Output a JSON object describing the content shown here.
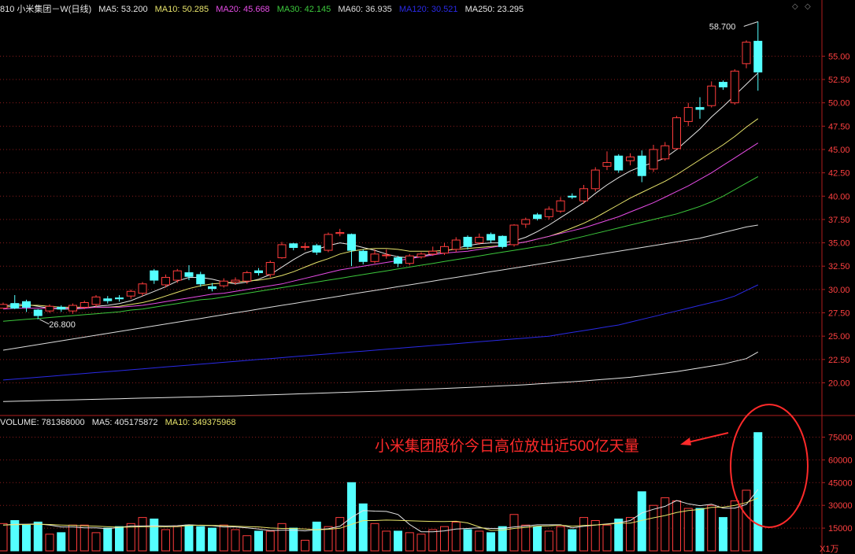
{
  "header": {
    "title": "810 小米集团－W(日线)",
    "ma5": "MA5: 53.200",
    "ma10": "MA10: 50.285",
    "ma20": "MA20: 45.668",
    "ma30": "MA30: 42.145",
    "ma60": "MA60: 36.935",
    "ma120": "MA120: 30.521",
    "ma250": "MA250: 23.295"
  },
  "volume_header": {
    "volume": "VOLUME: 781368000",
    "ma5": "MA5: 405175872",
    "ma10": "MA10: 349375968"
  },
  "annotation": "小米集团股价今日高位放出近500亿天量",
  "colors": {
    "up": "#ff3c3c",
    "down": "#54ffff",
    "ma5": "#e6e6e6",
    "ma10": "#e8e46b",
    "ma20": "#e64ce6",
    "ma30": "#3cc83c",
    "ma60": "#dcdcdc",
    "ma120": "#2a2ae6",
    "ma250": "#e6e6e6",
    "grid": "#8a1c1c",
    "annotation": "#ff2a2a"
  },
  "chart_data": [
    {
      "type": "candlestick",
      "title": "810 小米集团－W(日线)",
      "y_ticks": [
        "55.00",
        "52.50",
        "50.00",
        "47.50",
        "45.00",
        "42.50",
        "40.00",
        "37.50",
        "35.00",
        "32.50",
        "30.00",
        "27.50",
        "25.00",
        "22.50",
        "20.00"
      ],
      "ylim": [
        16.5,
        59.5
      ],
      "high_marker": "58.700",
      "low_marker": "26.800",
      "candles": [
        [
          28.0,
          28.4,
          28.0,
          28.6
        ],
        [
          28.5,
          28.0,
          27.9,
          29.4
        ],
        [
          28.7,
          28.1,
          27.6,
          28.9
        ],
        [
          27.8,
          27.2,
          26.8,
          27.9
        ],
        [
          27.7,
          28.2,
          27.5,
          28.4
        ],
        [
          28.1,
          27.9,
          27.6,
          28.3
        ],
        [
          27.7,
          28.3,
          27.4,
          28.5
        ],
        [
          28.1,
          28.6,
          27.9,
          28.8
        ],
        [
          28.4,
          29.2,
          28.1,
          29.4
        ],
        [
          29.0,
          28.8,
          28.5,
          29.3
        ],
        [
          29.1,
          29.0,
          28.7,
          29.4
        ],
        [
          29.3,
          29.8,
          29.0,
          30.0
        ],
        [
          29.6,
          30.6,
          29.3,
          30.8
        ],
        [
          32.0,
          31.0,
          30.6,
          32.2
        ],
        [
          30.5,
          31.3,
          30.2,
          31.6
        ],
        [
          31.0,
          32.0,
          30.7,
          32.2
        ],
        [
          31.8,
          31.4,
          31.0,
          32.6
        ],
        [
          31.6,
          30.6,
          30.3,
          31.9
        ],
        [
          30.3,
          30.1,
          29.8,
          30.7
        ],
        [
          30.4,
          30.9,
          30.2,
          31.2
        ],
        [
          30.8,
          31.0,
          30.5,
          31.3
        ],
        [
          30.9,
          31.8,
          30.6,
          32.0
        ],
        [
          32.0,
          31.8,
          31.5,
          32.3
        ],
        [
          31.6,
          32.9,
          31.3,
          33.1
        ],
        [
          33.4,
          34.8,
          33.3,
          35.1
        ],
        [
          34.9,
          34.5,
          34.2,
          35.0
        ],
        [
          34.6,
          34.6,
          34.2,
          35.0
        ],
        [
          34.7,
          34.0,
          33.7,
          34.9
        ],
        [
          34.2,
          35.9,
          34.0,
          36.1
        ],
        [
          36.0,
          36.1,
          35.7,
          36.5
        ],
        [
          35.9,
          34.2,
          32.5,
          36.0
        ],
        [
          34.1,
          33.0,
          32.7,
          34.3
        ],
        [
          33.0,
          33.8,
          32.8,
          34.3
        ],
        [
          33.7,
          33.7,
          33.3,
          34.3
        ],
        [
          33.4,
          32.8,
          32.4,
          33.6
        ],
        [
          32.8,
          33.6,
          32.6,
          33.8
        ],
        [
          33.5,
          33.8,
          33.3,
          34.0
        ],
        [
          33.8,
          34.1,
          33.6,
          34.6
        ],
        [
          33.9,
          34.6,
          33.7,
          35.0
        ],
        [
          34.3,
          35.3,
          34.0,
          35.6
        ],
        [
          35.6,
          34.6,
          34.3,
          35.8
        ],
        [
          35.0,
          35.6,
          34.8,
          36.0
        ],
        [
          35.9,
          35.3,
          35.0,
          36.1
        ],
        [
          35.7,
          34.6,
          34.4,
          35.8
        ],
        [
          34.8,
          36.9,
          34.6,
          37.0
        ],
        [
          37.0,
          37.5,
          36.6,
          37.7
        ],
        [
          38.0,
          37.6,
          37.4,
          38.2
        ],
        [
          37.8,
          38.6,
          37.5,
          38.9
        ],
        [
          38.4,
          39.5,
          38.2,
          39.9
        ],
        [
          40.0,
          39.9,
          39.7,
          40.3
        ],
        [
          39.5,
          40.8,
          39.2,
          41.2
        ],
        [
          40.8,
          42.8,
          40.5,
          43.1
        ],
        [
          43.2,
          43.6,
          42.8,
          44.8
        ],
        [
          44.3,
          42.8,
          42.5,
          44.5
        ],
        [
          43.8,
          44.2,
          43.3,
          44.6
        ],
        [
          44.3,
          42.2,
          41.5,
          44.9
        ],
        [
          42.9,
          45.0,
          42.6,
          45.5
        ],
        [
          44.0,
          45.4,
          43.8,
          45.8
        ],
        [
          45.1,
          48.4,
          45.0,
          48.6
        ],
        [
          48.0,
          49.5,
          47.5,
          50.0
        ],
        [
          49.5,
          49.3,
          48.3,
          50.6
        ],
        [
          49.7,
          51.8,
          49.5,
          52.3
        ],
        [
          52.2,
          51.7,
          51.4,
          52.4
        ],
        [
          50.0,
          53.4,
          49.8,
          53.6
        ],
        [
          54.2,
          56.5,
          53.7,
          56.7
        ],
        [
          56.6,
          53.3,
          51.3,
          58.7
        ]
      ],
      "ma_series": [
        {
          "name": "MA5",
          "values": [
            28.2,
            28.4,
            28.4,
            28.2,
            28.0,
            27.9,
            27.9,
            28.0,
            28.2,
            28.3,
            28.5,
            28.8,
            29.3,
            29.8,
            30.3,
            30.9,
            31.3,
            31.3,
            31.1,
            30.8,
            30.6,
            30.8,
            31.1,
            31.6,
            32.4,
            33.2,
            33.9,
            34.3,
            34.7,
            35.0,
            34.8,
            34.5,
            34.2,
            33.8,
            33.5,
            33.4,
            33.6,
            33.8,
            34.1,
            34.4,
            34.7,
            34.9,
            35.0,
            35.0,
            35.2,
            35.6,
            36.2,
            36.9,
            37.7,
            38.5,
            39.3,
            40.3,
            41.2,
            42.0,
            42.7,
            43.2,
            43.6,
            44.1,
            45.0,
            46.1,
            47.2,
            48.5,
            49.6,
            50.8,
            52.0,
            53.2
          ]
        },
        {
          "name": "MA10",
          "values": [
            28.1,
            28.2,
            28.3,
            28.3,
            28.2,
            28.1,
            28.1,
            28.1,
            28.1,
            28.1,
            28.2,
            28.4,
            28.6,
            28.9,
            29.3,
            29.7,
            30.1,
            30.4,
            30.6,
            30.7,
            30.8,
            30.9,
            31.0,
            31.2,
            31.5,
            31.9,
            32.4,
            32.9,
            33.3,
            33.8,
            34.1,
            34.3,
            34.4,
            34.4,
            34.3,
            34.1,
            34.1,
            34.1,
            34.2,
            34.3,
            34.4,
            34.5,
            34.6,
            34.7,
            34.9,
            35.1,
            35.4,
            35.7,
            36.1,
            36.6,
            37.1,
            37.7,
            38.4,
            39.1,
            39.8,
            40.4,
            41.0,
            41.6,
            42.3,
            43.1,
            43.9,
            44.7,
            45.5,
            46.4,
            47.4,
            48.3
          ]
        },
        {
          "name": "MA20",
          "values": [
            27.9,
            28.0,
            28.0,
            28.0,
            28.0,
            28.0,
            28.0,
            28.0,
            28.1,
            28.1,
            28.1,
            28.2,
            28.3,
            28.5,
            28.7,
            28.9,
            29.1,
            29.3,
            29.5,
            29.6,
            29.8,
            30.0,
            30.2,
            30.4,
            30.6,
            30.9,
            31.2,
            31.5,
            31.8,
            32.1,
            32.3,
            32.5,
            32.7,
            32.9,
            33.1,
            33.3,
            33.5,
            33.7,
            33.9,
            34.0,
            34.1,
            34.3,
            34.5,
            34.7,
            34.9,
            35.1,
            35.4,
            35.7,
            36.0,
            36.3,
            36.6,
            37.0,
            37.4,
            37.8,
            38.3,
            38.8,
            39.3,
            39.9,
            40.5,
            41.1,
            41.8,
            42.5,
            43.3,
            44.1,
            44.9,
            45.7
          ]
        },
        {
          "name": "MA30",
          "values": [
            26.6,
            26.7,
            26.8,
            26.9,
            27.0,
            27.1,
            27.2,
            27.3,
            27.4,
            27.5,
            27.6,
            27.8,
            27.9,
            28.1,
            28.3,
            28.5,
            28.7,
            28.9,
            29.0,
            29.2,
            29.4,
            29.6,
            29.8,
            30.0,
            30.2,
            30.4,
            30.6,
            30.8,
            31.0,
            31.2,
            31.4,
            31.6,
            31.8,
            32.0,
            32.2,
            32.4,
            32.6,
            32.8,
            33.0,
            33.2,
            33.4,
            33.6,
            33.8,
            34.0,
            34.2,
            34.4,
            34.6,
            34.8,
            35.1,
            35.4,
            35.7,
            36.0,
            36.3,
            36.6,
            36.9,
            37.2,
            37.5,
            37.8,
            38.1,
            38.5,
            38.9,
            39.4,
            40.0,
            40.7,
            41.4,
            42.1
          ]
        },
        {
          "name": "MA60",
          "values": [
            23.5,
            23.7,
            23.9,
            24.1,
            24.3,
            24.5,
            24.7,
            24.9,
            25.1,
            25.3,
            25.5,
            25.7,
            25.9,
            26.1,
            26.3,
            26.5,
            26.7,
            26.9,
            27.1,
            27.3,
            27.5,
            27.7,
            27.9,
            28.1,
            28.3,
            28.5,
            28.7,
            28.9,
            29.1,
            29.3,
            29.5,
            29.7,
            29.9,
            30.1,
            30.3,
            30.5,
            30.7,
            30.9,
            31.1,
            31.3,
            31.5,
            31.7,
            31.9,
            32.1,
            32.3,
            32.5,
            32.7,
            32.9,
            33.1,
            33.3,
            33.5,
            33.7,
            33.9,
            34.1,
            34.3,
            34.5,
            34.7,
            34.9,
            35.1,
            35.3,
            35.5,
            35.8,
            36.1,
            36.4,
            36.7,
            36.9
          ]
        },
        {
          "name": "MA120",
          "values": [
            20.3,
            20.4,
            20.5,
            20.6,
            20.7,
            20.8,
            20.9,
            21.0,
            21.1,
            21.2,
            21.3,
            21.4,
            21.5,
            21.6,
            21.7,
            21.8,
            21.9,
            22.0,
            22.1,
            22.2,
            22.3,
            22.4,
            22.5,
            22.6,
            22.7,
            22.8,
            22.9,
            23.0,
            23.1,
            23.2,
            23.3,
            23.4,
            23.5,
            23.6,
            23.7,
            23.8,
            23.9,
            24.0,
            24.1,
            24.2,
            24.3,
            24.4,
            24.5,
            24.6,
            24.7,
            24.8,
            24.9,
            25.0,
            25.2,
            25.4,
            25.6,
            25.8,
            26.0,
            26.2,
            26.5,
            26.8,
            27.1,
            27.4,
            27.7,
            28.0,
            28.3,
            28.6,
            28.9,
            29.3,
            29.9,
            30.5
          ]
        },
        {
          "name": "MA250",
          "values": [
            18.0,
            18.03,
            18.06,
            18.09,
            18.12,
            18.15,
            18.18,
            18.21,
            18.24,
            18.27,
            18.3,
            18.33,
            18.36,
            18.39,
            18.42,
            18.45,
            18.48,
            18.51,
            18.54,
            18.57,
            18.6,
            18.64,
            18.68,
            18.72,
            18.76,
            18.8,
            18.84,
            18.88,
            18.92,
            18.96,
            19.0,
            19.05,
            19.1,
            19.15,
            19.2,
            19.25,
            19.3,
            19.35,
            19.4,
            19.45,
            19.5,
            19.56,
            19.62,
            19.68,
            19.74,
            19.8,
            19.88,
            19.96,
            20.04,
            20.12,
            20.2,
            20.3,
            20.4,
            20.5,
            20.6,
            20.75,
            20.9,
            21.05,
            21.2,
            21.4,
            21.6,
            21.8,
            22.0,
            22.3,
            22.6,
            23.3
          ]
        }
      ]
    },
    {
      "type": "bar",
      "title": "VOLUME",
      "y_ticks": [
        "75000",
        "60000",
        "45000",
        "30000",
        "15000"
      ],
      "unit": "X1万",
      "ylim": [
        0,
        82000
      ],
      "values": [
        18000,
        20000,
        17000,
        19000,
        11000,
        12000,
        17000,
        17000,
        12000,
        15000,
        16000,
        18000,
        22000,
        21000,
        14000,
        16000,
        17000,
        16000,
        15000,
        17000,
        14000,
        10000,
        13000,
        13000,
        18000,
        15000,
        7000,
        19000,
        16000,
        22000,
        45000,
        31000,
        18000,
        13000,
        13000,
        12000,
        11000,
        14000,
        16000,
        19000,
        14000,
        13000,
        12000,
        16000,
        24000,
        17000,
        16000,
        13000,
        16000,
        14000,
        22000,
        20000,
        17000,
        21000,
        22000,
        39000,
        30000,
        35000,
        33000,
        28000,
        28000,
        30000,
        22000,
        33000,
        40000,
        78000
      ],
      "ma_series": [
        {
          "name": "MA5",
          "values": [
            17000,
            17500,
            17600,
            17800,
            17000,
            15800,
            15800,
            15200,
            15200,
            14600,
            15400,
            16400,
            16400,
            16600,
            16400,
            16600,
            17200,
            16800,
            16600,
            15800,
            15800,
            15200,
            14400,
            13400,
            13600,
            13600,
            13200,
            14000,
            14600,
            16200,
            22000,
            26600,
            26200,
            26000,
            24000,
            17400,
            12600,
            12600,
            13200,
            14400,
            14800,
            15200,
            14800,
            14800,
            15800,
            16400,
            17200,
            17200,
            17200,
            15200,
            16200,
            17000,
            17800,
            18600,
            20000,
            25000,
            27400,
            29400,
            33200,
            31000,
            29800,
            30800,
            28200,
            28200,
            30600,
            40500
          ]
        },
        {
          "name": "MA10",
          "values": [
            17000,
            17300,
            17400,
            17600,
            17400,
            17000,
            16800,
            16500,
            16300,
            15900,
            15600,
            15700,
            15900,
            15900,
            15900,
            16000,
            16700,
            16900,
            16800,
            16600,
            16300,
            16000,
            15800,
            15100,
            14800,
            14800,
            14400,
            13900,
            14200,
            14900,
            17500,
            20000,
            20000,
            20300,
            20100,
            19900,
            19600,
            19400,
            19300,
            19500,
            18400,
            15800,
            13500,
            13700,
            14800,
            15400,
            16300,
            16500,
            16900,
            16300,
            16700,
            17100,
            17500,
            18200,
            18300,
            20100,
            21800,
            23300,
            25300,
            26600,
            27300,
            28700,
            28800,
            30000,
            31800,
            34900
          ]
        }
      ],
      "volume_header": "VOLUME: 781368000"
    }
  ]
}
